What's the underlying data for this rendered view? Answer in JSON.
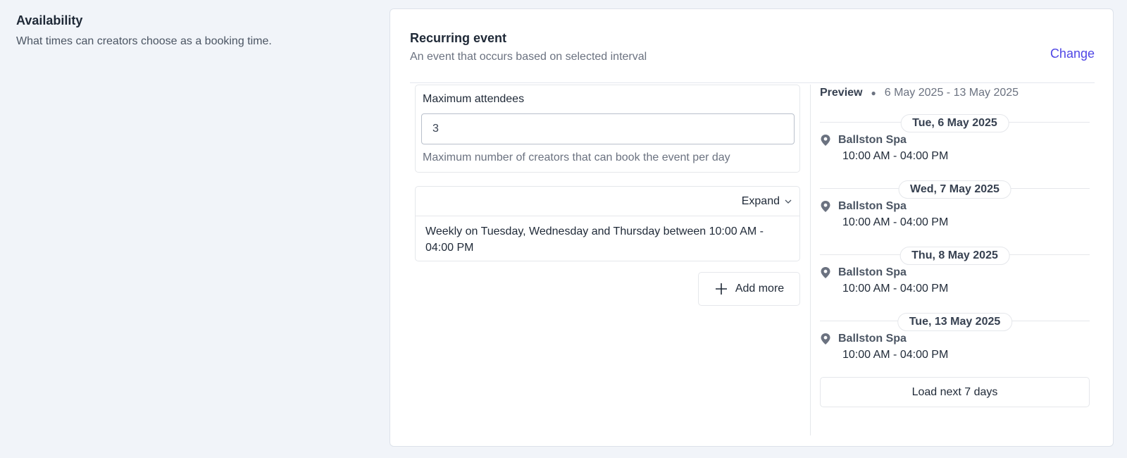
{
  "section": {
    "title": "Availability",
    "description": "What times can creators choose as a booking time."
  },
  "card": {
    "title": "Recurring event",
    "subtitle": "An event that occurs based on selected interval",
    "change_label": "Change"
  },
  "attendees": {
    "label": "Maximum attendees",
    "value": "3",
    "help": "Maximum number of creators that can book the event per day"
  },
  "rule": {
    "expand_label": "Expand",
    "text": "Weekly on Tuesday, Wednesday and Thursday between 10:00 AM - 04:00 PM"
  },
  "add_more_label": "Add more",
  "preview": {
    "label": "Preview",
    "range": "6 May 2025 - 13 May 2025",
    "days": [
      {
        "date": "Tue, 6 May 2025",
        "location": "Ballston Spa",
        "time": "10:00 AM - 04:00 PM"
      },
      {
        "date": "Wed, 7 May 2025",
        "location": "Ballston Spa",
        "time": "10:00 AM - 04:00 PM"
      },
      {
        "date": "Thu, 8 May 2025",
        "location": "Ballston Spa",
        "time": "10:00 AM - 04:00 PM"
      },
      {
        "date": "Tue, 13 May 2025",
        "location": "Ballston Spa",
        "time": "10:00 AM - 04:00 PM"
      }
    ],
    "load_more_label": "Load next 7 days"
  },
  "colors": {
    "accent": "#4f46e5",
    "background": "#f1f4f9",
    "icon": "#6b7280"
  },
  "icons": {
    "location": "map-pin-icon",
    "expand": "chevron-down-icon",
    "add": "plus-icon"
  }
}
